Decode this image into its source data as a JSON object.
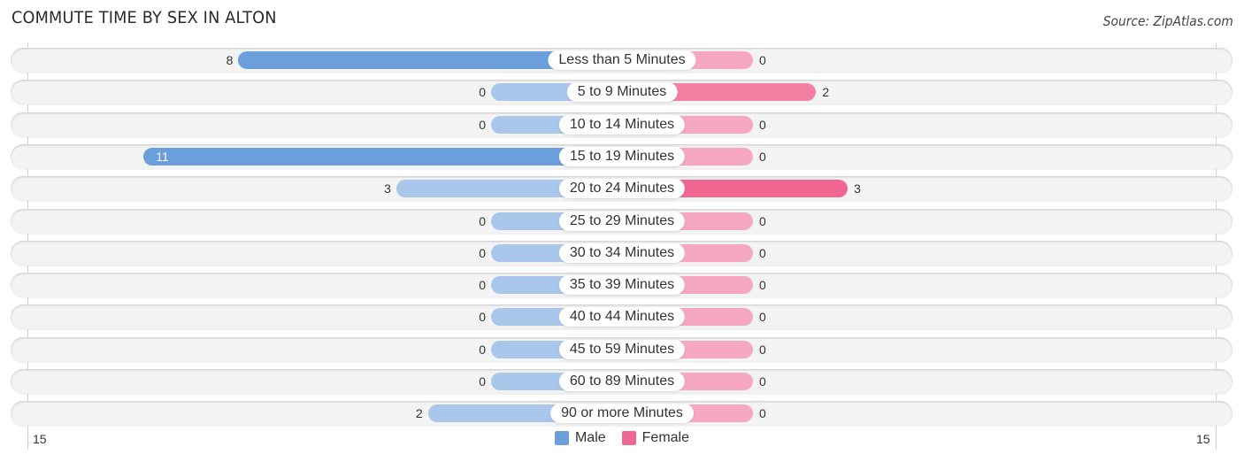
{
  "header": {
    "title": "COMMUTE TIME BY SEX IN ALTON",
    "source": "Source: ZipAtlas.com"
  },
  "colors": {
    "male_strong": "#6a9fdb",
    "male_light": "#a9c7ea",
    "female_strong": "#f06792",
    "female_light": "#f7a8c1",
    "row_bg": "#f3f3f3"
  },
  "chart_data": {
    "type": "bar",
    "orientation": "horizontal-diverging",
    "title": "COMMUTE TIME BY SEX IN ALTON",
    "categories": [
      "Less than 5 Minutes",
      "5 to 9 Minutes",
      "10 to 14 Minutes",
      "15 to 19 Minutes",
      "20 to 24 Minutes",
      "25 to 29 Minutes",
      "30 to 34 Minutes",
      "35 to 39 Minutes",
      "40 to 44 Minutes",
      "45 to 59 Minutes",
      "60 to 89 Minutes",
      "90 or more Minutes"
    ],
    "series": [
      {
        "name": "Male",
        "values": [
          8,
          0,
          0,
          11,
          3,
          0,
          0,
          0,
          0,
          0,
          0,
          2
        ]
      },
      {
        "name": "Female",
        "values": [
          0,
          2,
          0,
          0,
          3,
          0,
          0,
          0,
          0,
          0,
          0,
          0
        ]
      }
    ],
    "xlim": [
      -15,
      15
    ],
    "axis_tick_labels": {
      "left": "15",
      "right": "15"
    },
    "legend": {
      "position": "bottom-center",
      "entries": [
        "Male",
        "Female"
      ]
    },
    "xlabel": "",
    "ylabel": "",
    "grid": false
  }
}
